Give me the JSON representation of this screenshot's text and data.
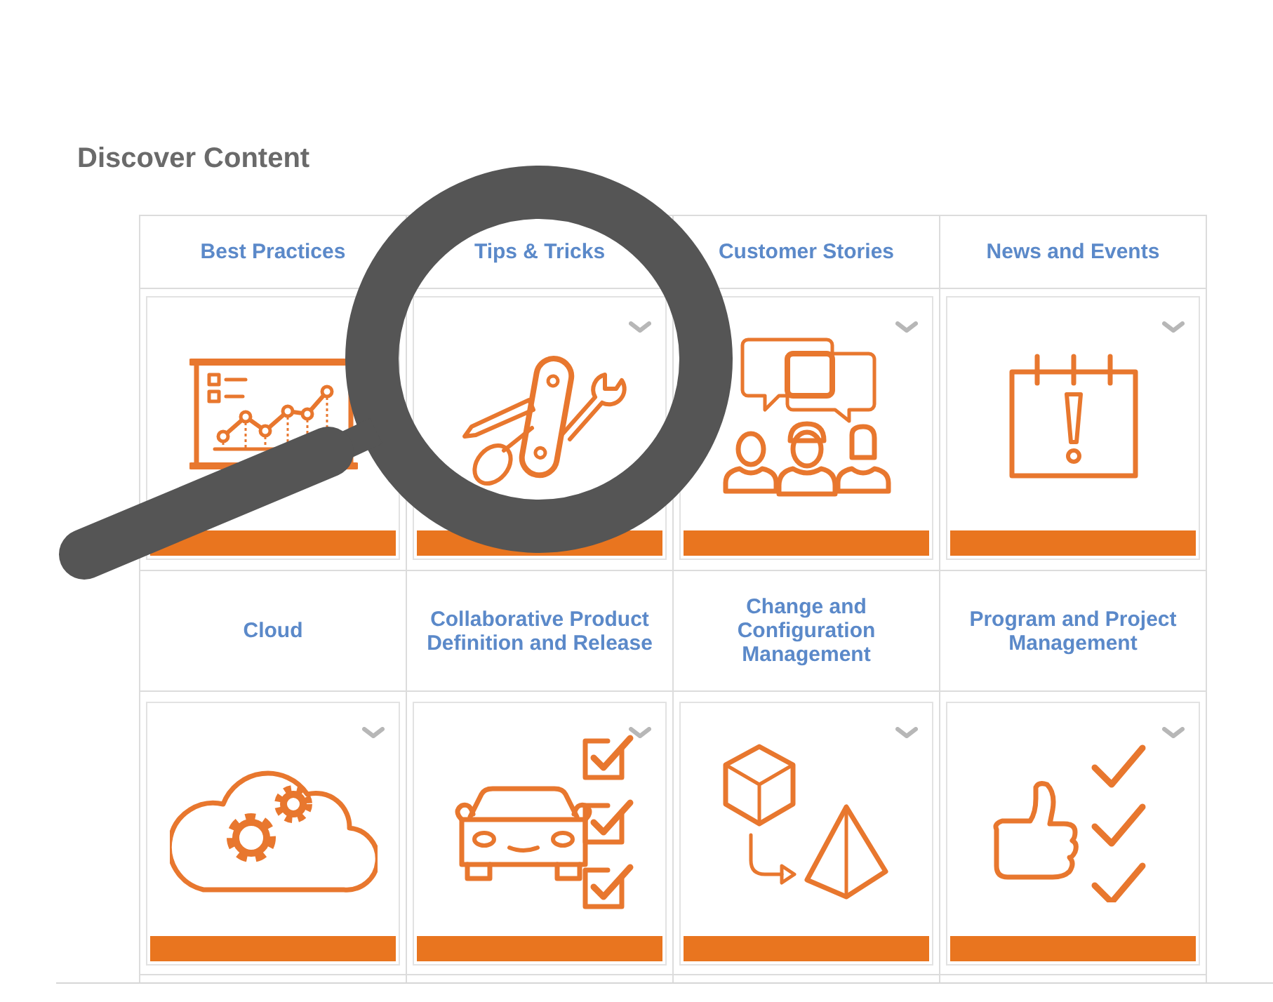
{
  "heading": "Discover Content",
  "categories": [
    {
      "title": "Best Practices"
    },
    {
      "title": "Tips & Tricks"
    },
    {
      "title": "Customer Stories"
    },
    {
      "title": "News and Events"
    },
    {
      "title": "Cloud"
    },
    {
      "title": "Collaborative Product Definition and Release"
    },
    {
      "title": "Change and Configuration Management"
    },
    {
      "title": "Program and Project Management"
    }
  ]
}
